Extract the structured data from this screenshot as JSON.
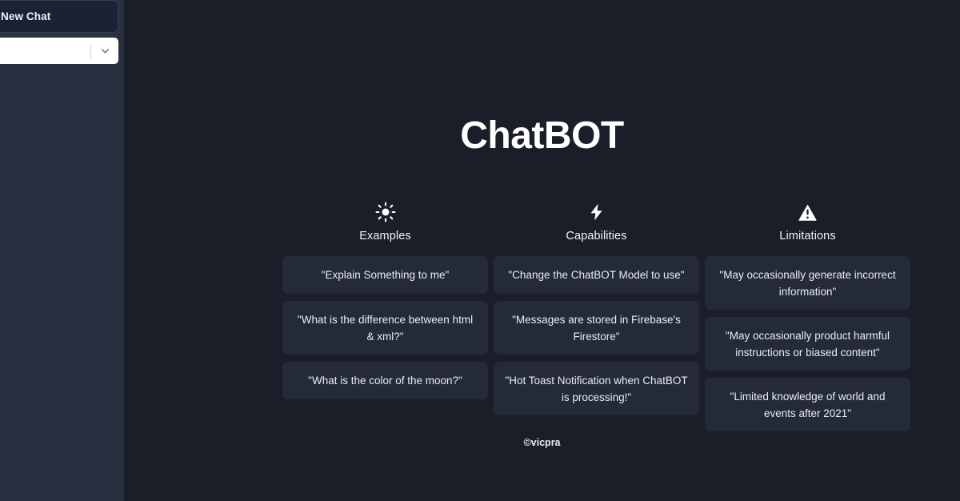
{
  "sidebar": {
    "new_chat_label": "New Chat",
    "model_select": {
      "value": "",
      "placeholder": "",
      "icon": "chevron-down-icon"
    },
    "background_color": "#2b3040"
  },
  "main": {
    "title": "ChatBOT",
    "background_color": "#1a1e29",
    "card_color": "#242a38",
    "footer": "©vicpra",
    "columns": [
      {
        "id": "examples",
        "icon": "sun-icon",
        "title": "Examples",
        "cards": [
          {
            "text": "\"Explain Something to me\"",
            "lines": 1
          },
          {
            "text": "\"What is the difference between html & xml?\"",
            "lines": 2
          },
          {
            "text": "\"What is the color of the moon?\"",
            "lines": 1
          }
        ]
      },
      {
        "id": "capabilities",
        "icon": "lightning-bolt-icon",
        "title": "Capabilities",
        "cards": [
          {
            "text": "\"Change the ChatBOT Model to use\"",
            "lines": 1
          },
          {
            "text": "\"Messages are stored in Firebase's Firestore\"",
            "lines": 2
          },
          {
            "text": "\"Hot Toast Notification when ChatBOT is processing!\"",
            "lines": 2
          }
        ]
      },
      {
        "id": "limitations",
        "icon": "warning-triangle-icon",
        "title": "Limitations",
        "cards": [
          {
            "text": "\"May occasionally generate incorrect information\"",
            "lines": 2
          },
          {
            "text": "\"May occasionally product harmful instructions or biased content\"",
            "lines": 2
          },
          {
            "text": "\"Limited knowledge of world and events after 2021\"",
            "lines": 2
          }
        ]
      }
    ]
  }
}
